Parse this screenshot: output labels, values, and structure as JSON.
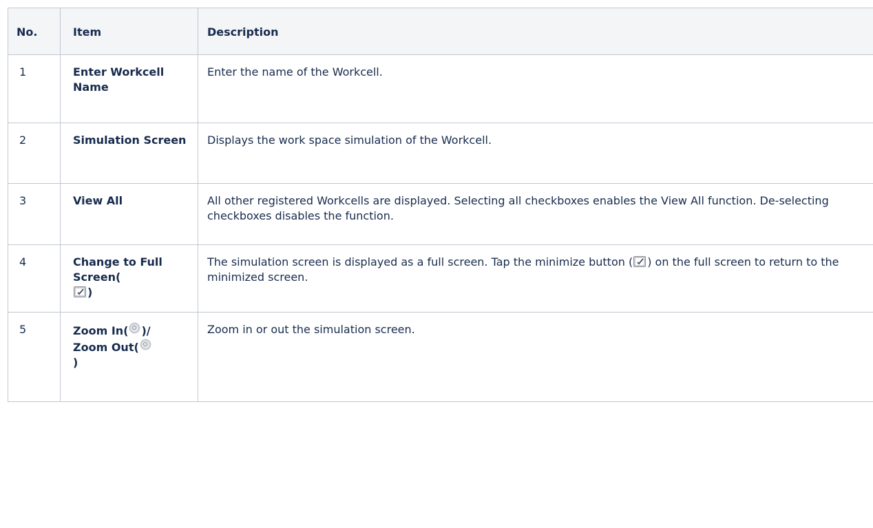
{
  "table": {
    "headers": {
      "no": "No.",
      "item": "Item",
      "description": "Description"
    },
    "rows": [
      {
        "no": "1",
        "item": "Enter Workcell Name",
        "description": "Enter the name of the Workcell."
      },
      {
        "no": "2",
        "item": "Simulation Screen",
        "description": "Displays the work space simulation of the Workcell."
      },
      {
        "no": "3",
        "item": "View All",
        "description": "All other registered Workcells are displayed. Selecting all checkboxes enables the View All function. De-selecting checkboxes disables the function."
      },
      {
        "no": "4",
        "item_before_icon": "Change to Full Screen(",
        "item_after_icon": ")",
        "description_before_icon": "The simulation screen is displayed as a full screen. Tap the minimize button (",
        "description_after_icon": ") on the full screen to return to the minimized screen.",
        "icon": "fullscreen-toggle-icon"
      },
      {
        "no": "5",
        "item_part1": "Zoom In(",
        "item_part2": ")/",
        "item_part3": "Zoom Out(",
        "item_part4": ")",
        "description": "Zoom in or out the simulation screen.",
        "icons": [
          "zoom-in-icon",
          "zoom-out-icon"
        ]
      }
    ]
  },
  "colors": {
    "text": "#172b4d",
    "header_background": "#f4f5f7",
    "border": "#c1c7d0"
  }
}
